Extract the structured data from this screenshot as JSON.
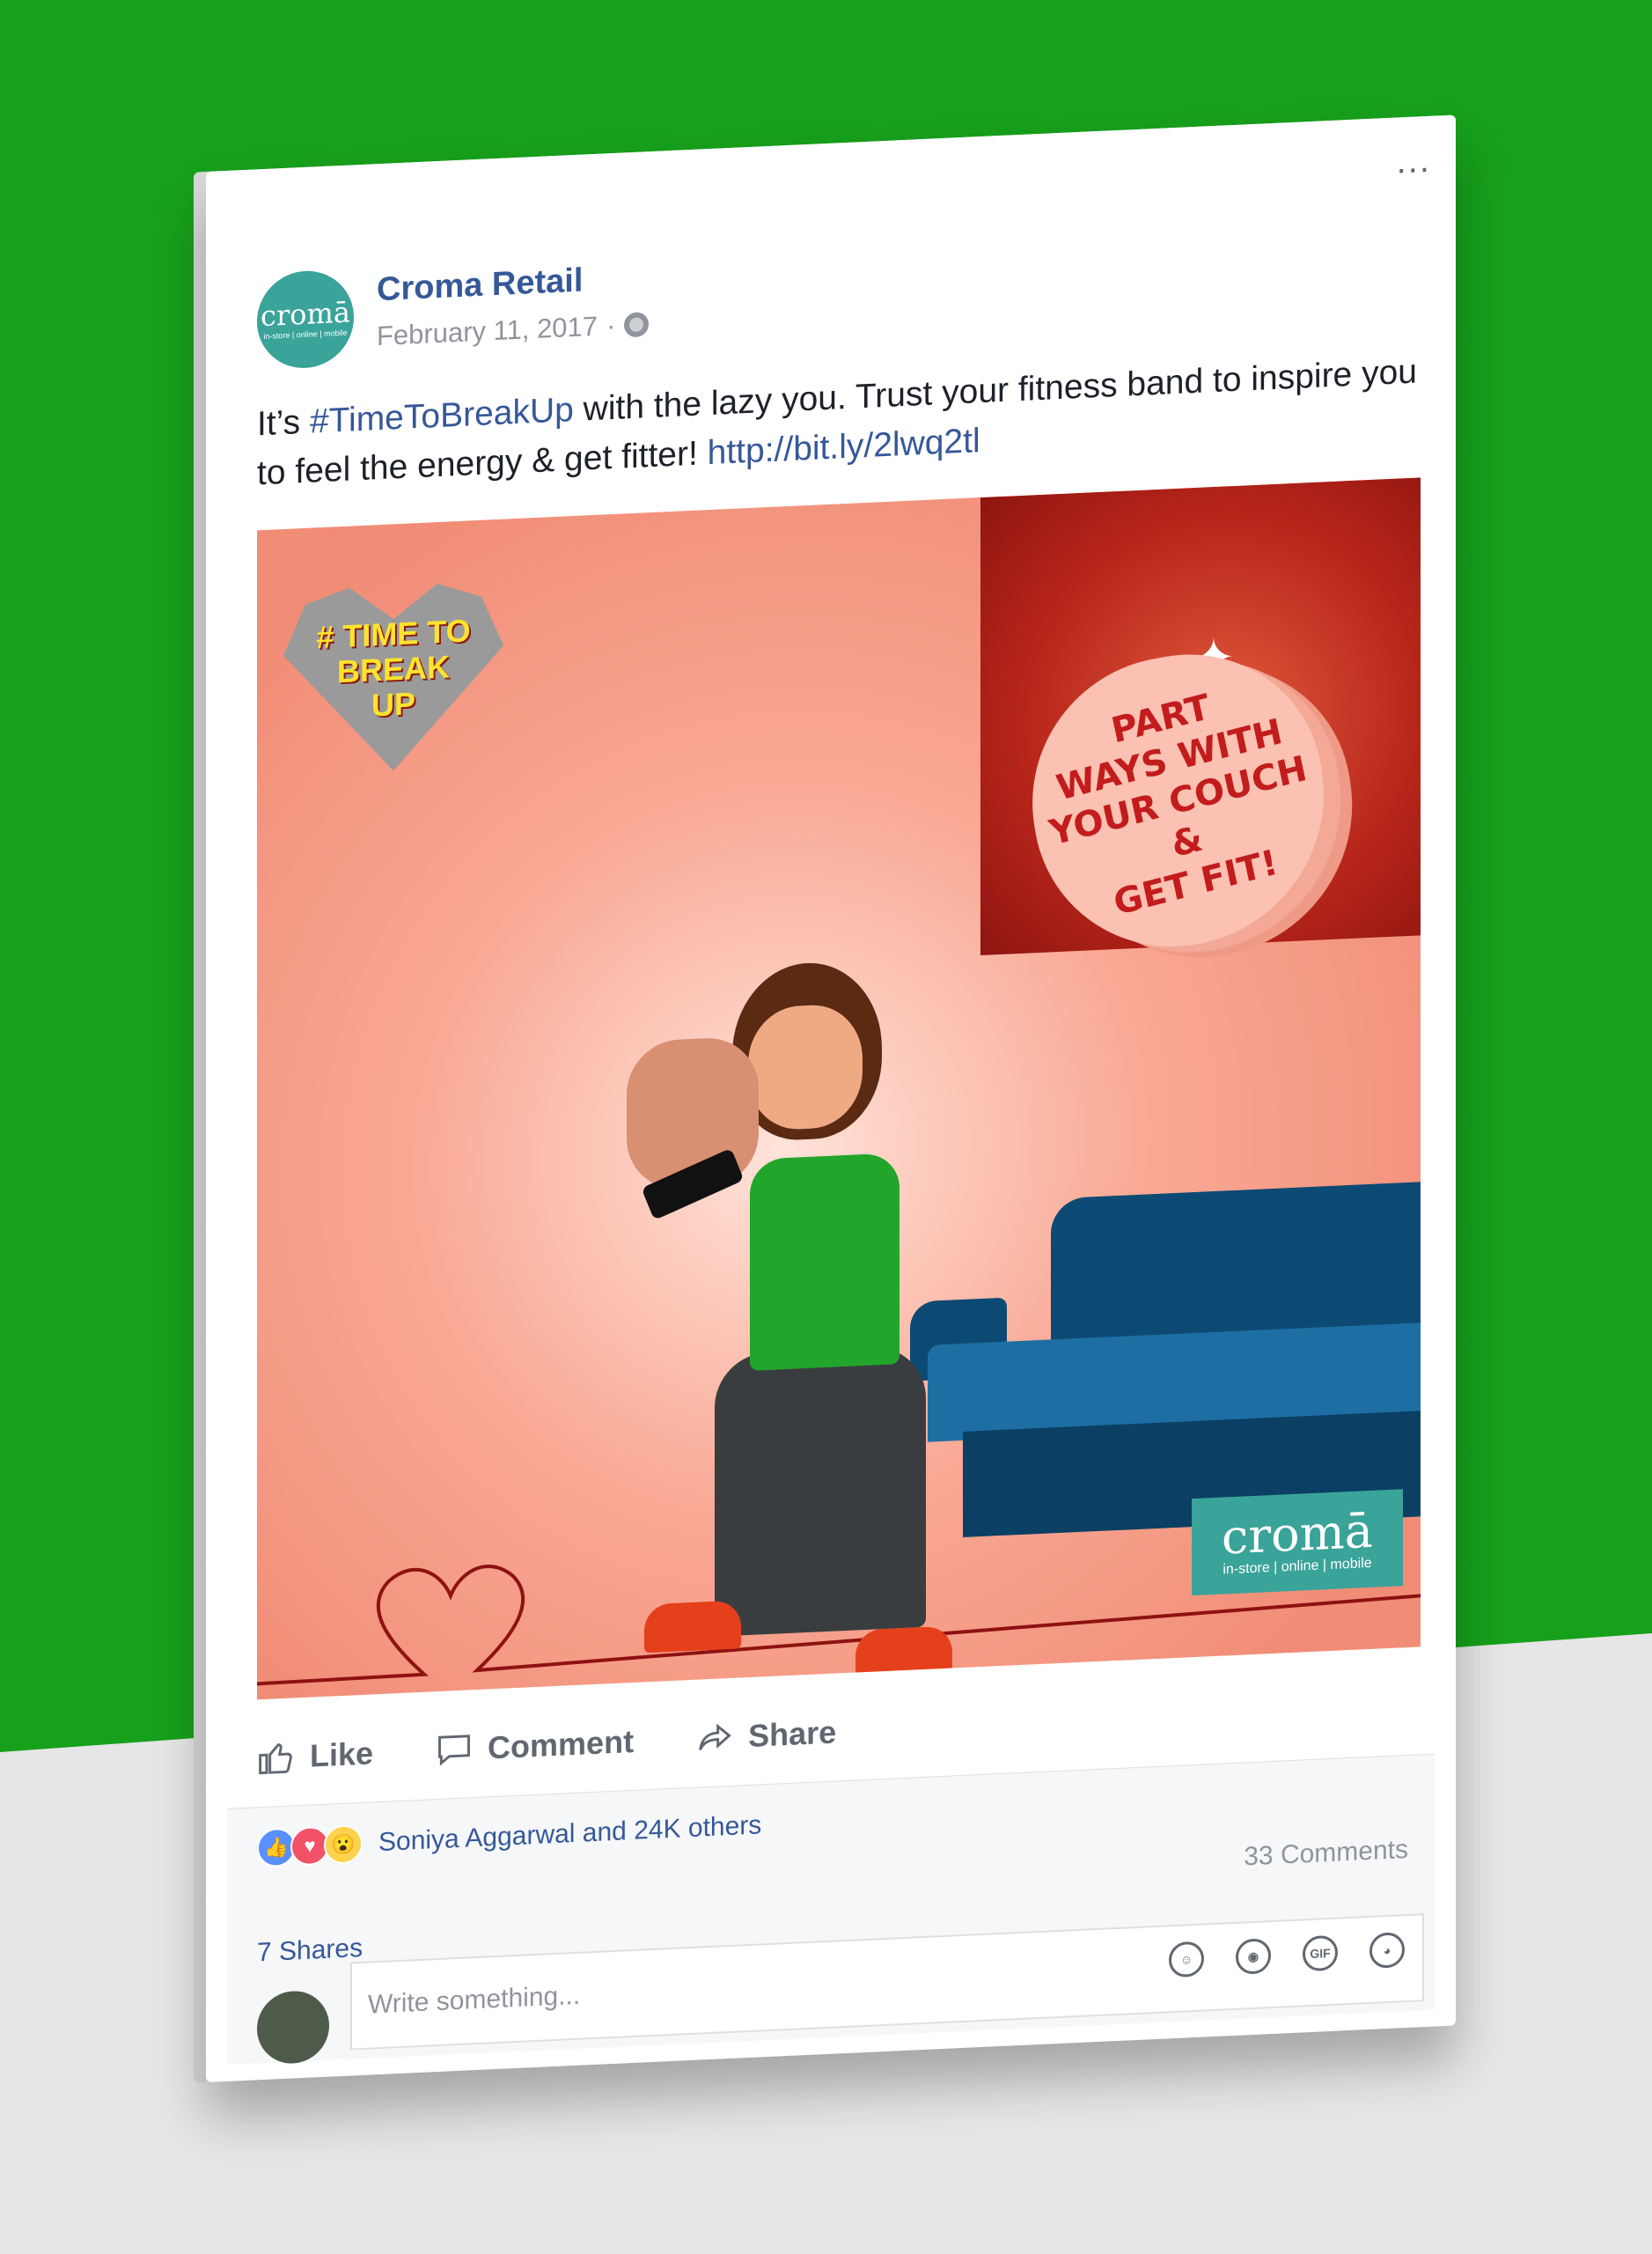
{
  "colors": {
    "background_top": "#17a01b",
    "background_bottom": "#e6e6e6",
    "link": "#365899",
    "brand": "#3aa39a"
  },
  "post": {
    "page_name": "Croma Retail",
    "date": "February 11, 2017",
    "date_separator": "·",
    "privacy_icon": "globe-icon",
    "text_prefix": "It’s ",
    "hashtag": "#TimeToBreakUp",
    "text_middle": " with the lazy you. Trust your fitness band to inspire you to feel the energy & get fitter! ",
    "link": "http://bit.ly/2lwq2tl",
    "menu_label": "..."
  },
  "page_avatar": {
    "wordmark": "cromā",
    "tagline": "in-store | online | mobile"
  },
  "image": {
    "badge_text": "# TIME TO\nBREAK\nUP",
    "heart_text": "PART\nWAYS WITH\nYOUR COUCH\n&\nGET FIT!",
    "brand_wordmark": "cromā",
    "brand_tagline": "in-store | online | mobile"
  },
  "actions": {
    "like": "Like",
    "comment": "Comment",
    "share": "Share"
  },
  "footer": {
    "reactions_text": "Soniya Aggarwal and 24K others",
    "comments_count": "33 Comments",
    "shares_count": "7 Shares",
    "comment_placeholder": "Write something...",
    "gif_label": "GIF"
  }
}
